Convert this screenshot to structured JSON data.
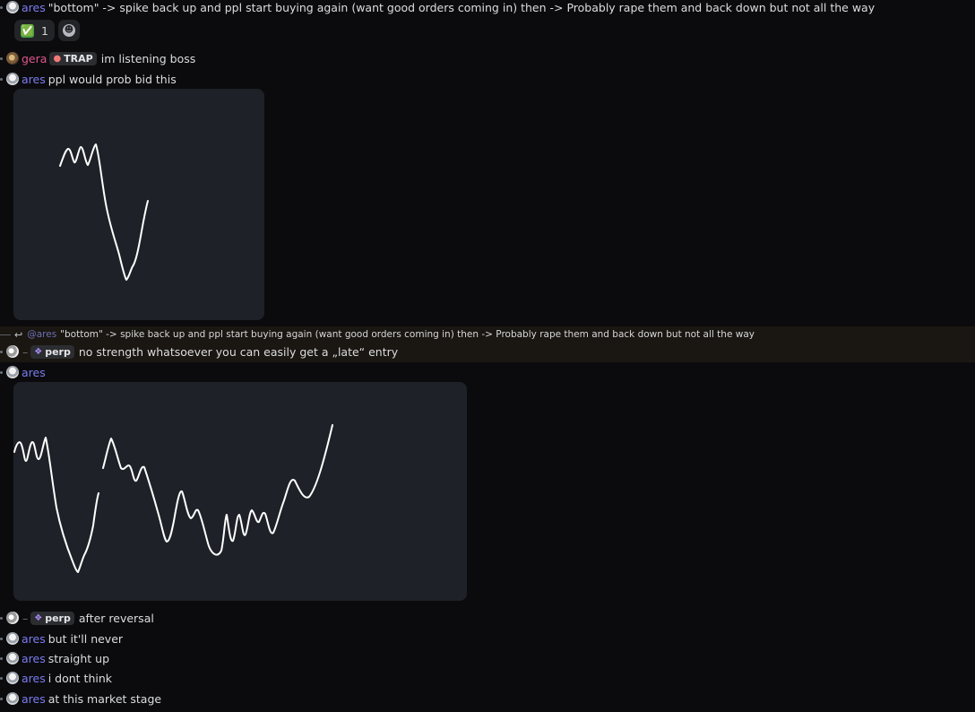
{
  "messages": [
    {
      "user": "ares",
      "text": "\"bottom\" -> spike back up and ppl start buying again (want good orders coming in) then -> Probably rape them and back down but not all the way"
    },
    {
      "user": "gera",
      "tag": "TRAP",
      "text": "im listening boss"
    },
    {
      "user": "ares",
      "text": "ppl would prob bid this"
    },
    {
      "user": "perp",
      "tag": "perp",
      "text": "no strength whatsoever you can easily get a „late“ entry"
    },
    {
      "user": "ares",
      "text": ""
    },
    {
      "user": "perp",
      "tag": "perp",
      "text": "after reversal"
    },
    {
      "user": "ares",
      "text": "but it'll never"
    },
    {
      "user": "ares",
      "text": "straight up"
    },
    {
      "user": "ares",
      "text": "i dont think"
    },
    {
      "user": "ares",
      "text": "at this market stage"
    }
  ],
  "reaction": {
    "emoji": "✅",
    "count": "1",
    "add_icon": "smile-plus-icon"
  },
  "reply": {
    "mention": "@ares",
    "text": "\"bottom\" -> spike back up and ppl start buying again (want good orders coming in) then -> Probably rape them and back down but not all the way"
  },
  "colors": {
    "ares": "#7b7cf0",
    "gera": "#e0558b",
    "background": "#0b0b0d",
    "image_bg": "#1e2127",
    "reply_highlight": "#1a1611"
  }
}
